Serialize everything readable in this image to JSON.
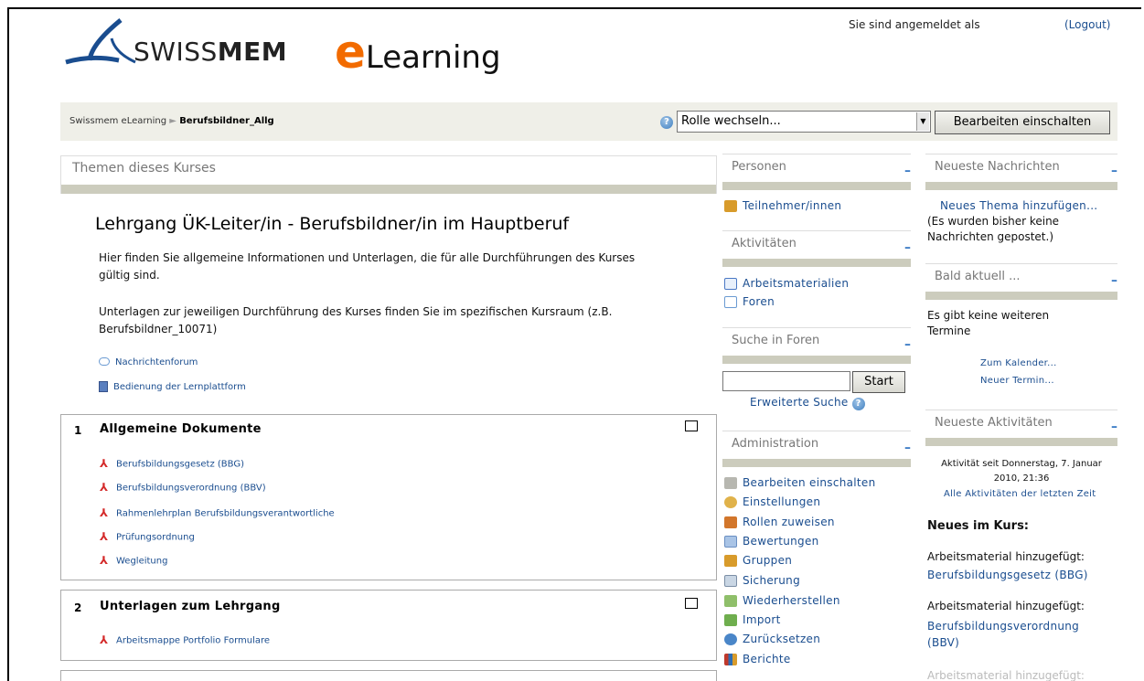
{
  "header": {
    "logo_brand_light": "SWISS",
    "logo_brand_bold": "MEM",
    "logo_e": "e",
    "logo_learning": "Learning",
    "login_text": "Sie sind angemeldet als",
    "logout_label": "(Logout)"
  },
  "navbar": {
    "breadcrumb_home": "Swissmem eLearning",
    "breadcrumb_sep": "►",
    "breadcrumb_current": "Berufsbildner_Allg",
    "help_glyph": "?",
    "role_select_value": "Rolle wechseln...",
    "edit_button": "Bearbeiten einschalten"
  },
  "main": {
    "topics_title": "Themen dieses Kurses",
    "course_title": "Lehrgang ÜK-Leiter/in - Berufsbildner/in im Hauptberuf",
    "para1": "Hier finden Sie allgemeine Informationen und Unterlagen, die für alle Durchführungen des Kurses gültig sind.",
    "para2": "Unterlagen zur jeweiligen Durchführung des Kurses finden Sie im spezifischen Kursraum (z.B. Berufsbildner_10071)",
    "intro_links": [
      {
        "label": "Nachrichtenforum",
        "icon": "forum-icon"
      },
      {
        "label": "Bedienung der Lernplattform",
        "icon": "document-icon"
      }
    ],
    "sections": [
      {
        "num": "1",
        "title": "Allgemeine Dokumente",
        "links": [
          "Berufsbildungsgesetz (BBG)",
          "Berufsbildungsverordnung (BBV)",
          "Rahmenlehrplan Berufsbildungsverantwortliche",
          "Prüfungsordnung",
          "Wegleitung"
        ]
      },
      {
        "num": "2",
        "title": "Unterlagen zum Lehrgang",
        "links": [
          "Arbeitsmappe Portfolio Formulare"
        ]
      }
    ]
  },
  "middle_col": {
    "personen_title": "Personen",
    "teilnehmer": "Teilnehmer/innen",
    "aktivitaeten_title": "Aktivitäten",
    "arbeitsmaterialien": "Arbeitsmaterialien",
    "foren": "Foren",
    "suche_title": "Suche in Foren",
    "search_value": "",
    "search_button": "Start",
    "erweiterte_suche": "Erweiterte Suche",
    "admin_title": "Administration",
    "admin_items": [
      "Bearbeiten einschalten",
      "Einstellungen",
      "Rollen zuweisen",
      "Bewertungen",
      "Gruppen",
      "Sicherung",
      "Wiederherstellen",
      "Import",
      "Zurücksetzen",
      "Berichte"
    ],
    "minimize_glyph": "–"
  },
  "right_col": {
    "nachrichten_title": "Neueste Nachrichten",
    "neues_thema": "Neues Thema hinzufügen...",
    "keine_nachrichten": "(Es wurden bisher keine Nachrichten gepostet.)",
    "bald_title": "Bald aktuell ...",
    "keine_termine": "Es gibt keine weiteren Termine",
    "zum_kalender": "Zum Kalender...",
    "neuer_termin": "Neuer Termin...",
    "aktivitaeten_title": "Neueste Aktivitäten",
    "aktivitaet_seit": "Aktivität seit Donnerstag, 7. Januar 2010, 21:36",
    "alle_aktivitaeten": "Alle Aktivitäten der letzten Zeit",
    "neues_im_kurs": "Neues im Kurs:",
    "news": [
      {
        "label": "Arbeitsmaterial hinzugefügt:",
        "link": "Berufsbildungsgesetz (BBG)"
      },
      {
        "label": "Arbeitsmaterial hinzugefügt:",
        "link": "Berufsbildungsverordnung (BBV)"
      }
    ],
    "cut_text": "Arbeitsmaterial hinzugefügt:"
  }
}
